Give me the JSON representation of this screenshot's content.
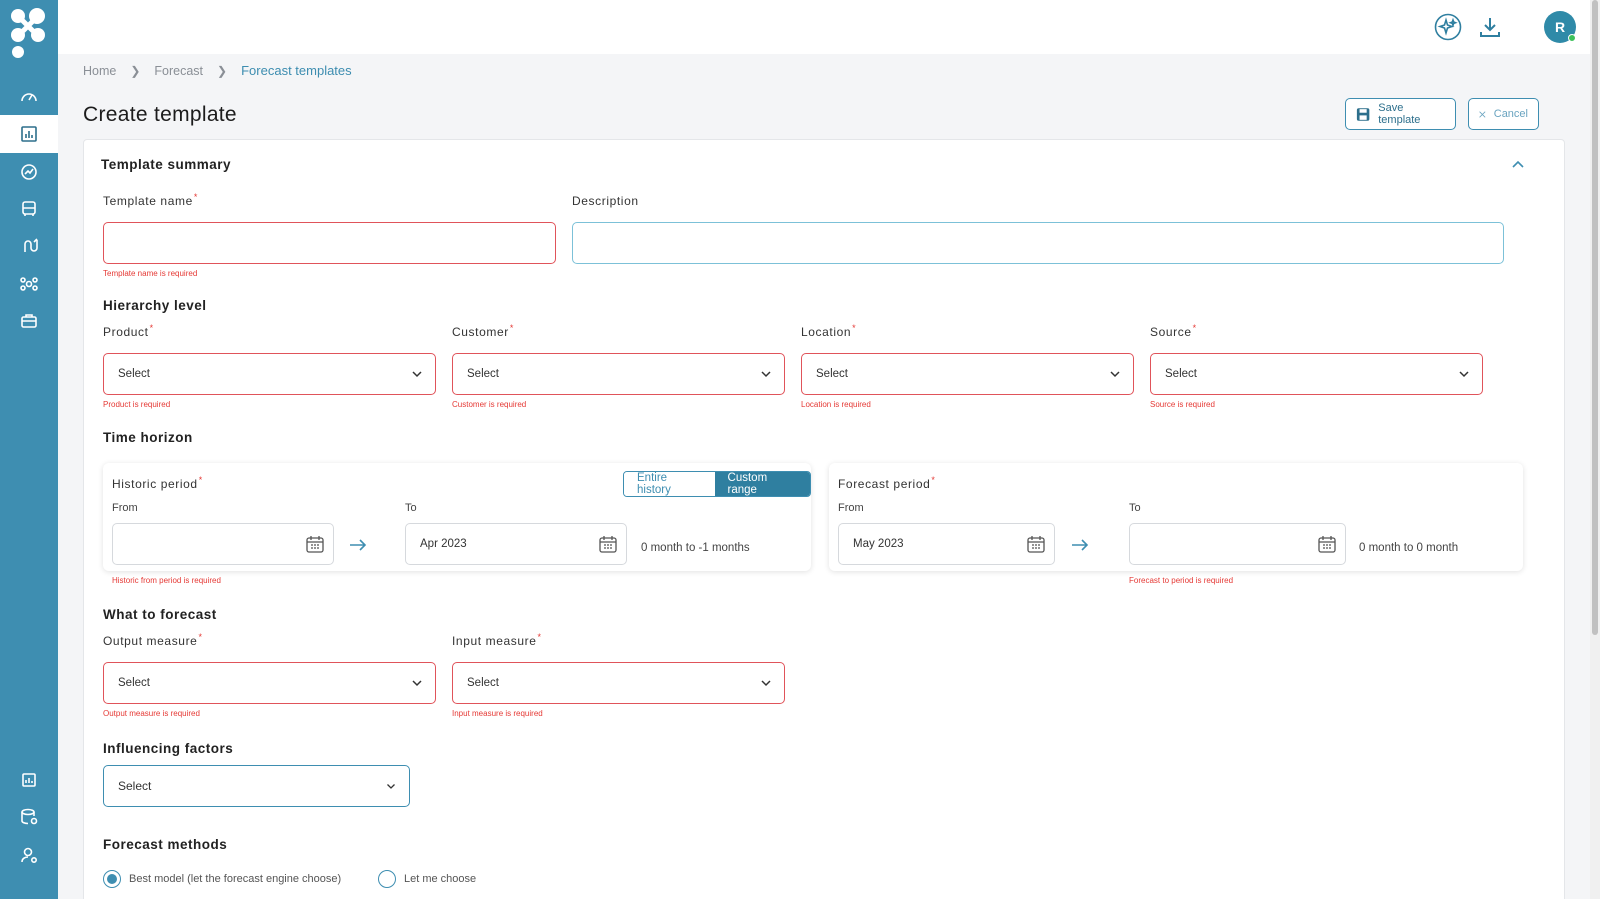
{
  "app": {
    "avatar_initial": "R"
  },
  "sidebar": {
    "items": [
      {
        "icon": "dashboard-gauge-icon"
      },
      {
        "icon": "bar-chart-icon",
        "active": true
      },
      {
        "icon": "trend-circle-icon"
      },
      {
        "icon": "bus-icon"
      },
      {
        "icon": "route-icon"
      },
      {
        "icon": "network-icon"
      },
      {
        "icon": "briefcase-icon"
      },
      {
        "icon": "report-icon"
      },
      {
        "icon": "database-settings-icon"
      },
      {
        "icon": "user-settings-icon"
      }
    ]
  },
  "breadcrumb": {
    "home": "Home",
    "forecast": "Forecast",
    "current": "Forecast templates"
  },
  "page": {
    "title": "Create template"
  },
  "actions": {
    "save": "Save template",
    "cancel": "Cancel"
  },
  "summary": {
    "title": "Template summary",
    "template_name_label": "Template name",
    "template_name_error": "Template name is required",
    "description_label": "Description"
  },
  "hierarchy": {
    "title": "Hierarchy level",
    "fields": [
      {
        "label": "Product",
        "value": "Select",
        "error": "Product is required"
      },
      {
        "label": "Customer",
        "value": "Select",
        "error": "Customer is required"
      },
      {
        "label": "Location",
        "value": "Select",
        "error": "Location is required"
      },
      {
        "label": "Source",
        "value": "Select",
        "error": "Source is required"
      }
    ]
  },
  "time_horizon": {
    "title": "Time horizon",
    "historic": {
      "label": "Historic period",
      "toggle_entire": "Entire history",
      "toggle_custom": "Custom range",
      "from_label": "From",
      "to_label": "To",
      "from_value": "",
      "to_value": "Apr 2023",
      "range_text": "0 month to -1 months",
      "error": "Historic from period is required"
    },
    "forecast": {
      "label": "Forecast period",
      "from_label": "From",
      "to_label": "To",
      "from_value": "May 2023",
      "to_value": "",
      "range_text": "0 month to 0 month",
      "error": "Forecast to period is required"
    }
  },
  "what_to_forecast": {
    "title": "What to forecast",
    "output_label": "Output measure",
    "output_value": "Select",
    "output_error": "Output measure is required",
    "input_label": "Input measure",
    "input_value": "Select",
    "input_error": "Input measure is required"
  },
  "influencing": {
    "title": "Influencing factors",
    "value": "Select"
  },
  "methods": {
    "title": "Forecast methods",
    "option_best": "Best model (let the forecast engine choose)",
    "option_manual": "Let me choose"
  },
  "colors": {
    "primary": "#3e8eb1",
    "error": "#e53935"
  }
}
